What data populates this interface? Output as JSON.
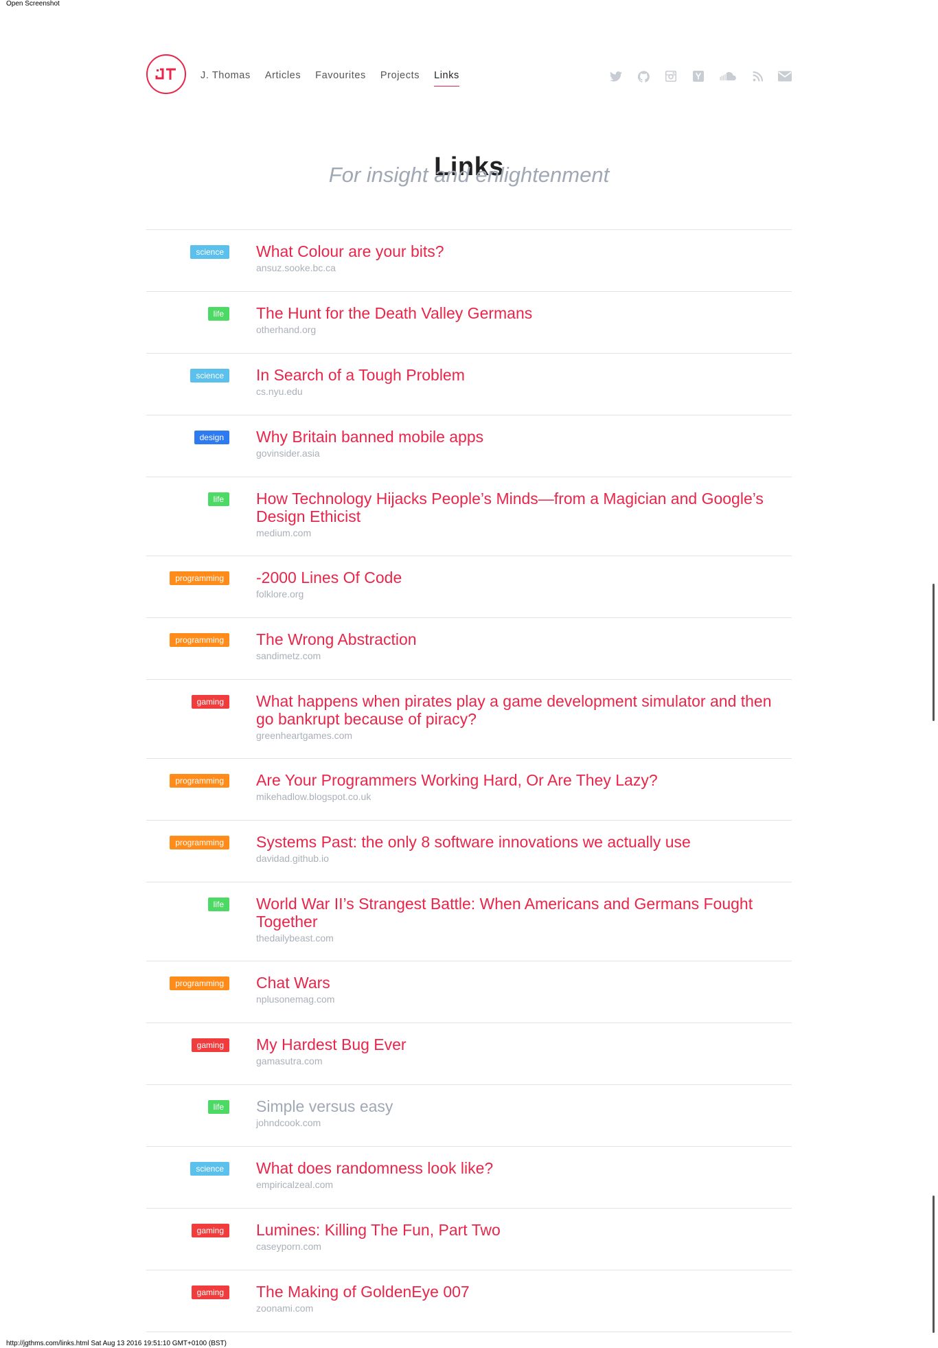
{
  "print": {
    "header": "Open Screenshot",
    "footer": "http://jgthms.com/links.html Sat Aug 13 2016 19:51:10 GMT+0100 (BST)"
  },
  "brand": {
    "logo_text": "JT",
    "accent": "#e8264a"
  },
  "nav": [
    {
      "label": "J. Thomas",
      "active": false
    },
    {
      "label": "Articles",
      "active": false
    },
    {
      "label": "Favourites",
      "active": false
    },
    {
      "label": "Projects",
      "active": false
    },
    {
      "label": "Links",
      "active": true
    }
  ],
  "social": [
    "twitter-icon",
    "github-icon",
    "instagram-icon",
    "hackernews-icon",
    "soundcloud-icon",
    "rss-icon",
    "email-icon"
  ],
  "page": {
    "title": "Links",
    "subtitle": "For insight and enlightenment"
  },
  "tag_colors": {
    "science": "#5bc0eb",
    "life": "#4cd964",
    "design": "#2e7af0",
    "programming": "#ff8c1a",
    "gaming": "#f03c3c"
  },
  "links": [
    {
      "tag": "science",
      "title": "What Colour are your bits?",
      "domain": "ansuz.sooke.bc.ca",
      "visited": false
    },
    {
      "tag": "life",
      "title": "The Hunt for the Death Valley Germans",
      "domain": "otherhand.org",
      "visited": false
    },
    {
      "tag": "science",
      "title": "In Search of a Tough Problem",
      "domain": "cs.nyu.edu",
      "visited": false
    },
    {
      "tag": "design",
      "title": "Why Britain banned mobile apps",
      "domain": "govinsider.asia",
      "visited": false
    },
    {
      "tag": "life",
      "title": "How Technology Hijacks People’s Minds—from a Magician and Google’s Design Ethicist",
      "domain": "medium.com",
      "visited": false
    },
    {
      "tag": "programming",
      "title": "-2000 Lines Of Code",
      "domain": "folklore.org",
      "visited": false
    },
    {
      "tag": "programming",
      "title": "The Wrong Abstraction",
      "domain": "sandimetz.com",
      "visited": false
    },
    {
      "tag": "gaming",
      "title": "What happens when pirates play a game development simulator and then go bankrupt because of piracy?",
      "domain": "greenheartgames.com",
      "visited": false
    },
    {
      "tag": "programming",
      "title": "Are Your Programmers Working Hard, Or Are They Lazy?",
      "domain": "mikehadlow.blogspot.co.uk",
      "visited": false
    },
    {
      "tag": "programming",
      "title": "Systems Past: the only 8 software innovations we actually use",
      "domain": "davidad.github.io",
      "visited": false
    },
    {
      "tag": "life",
      "title": "World War II’s Strangest Battle: When Americans and Germans Fought Together",
      "domain": "thedailybeast.com",
      "visited": false
    },
    {
      "tag": "programming",
      "title": "Chat Wars",
      "domain": "nplusonemag.com",
      "visited": false
    },
    {
      "tag": "gaming",
      "title": "My Hardest Bug Ever",
      "domain": "gamasutra.com",
      "visited": false
    },
    {
      "tag": "life",
      "title": "Simple versus easy",
      "domain": "johndcook.com",
      "visited": true
    },
    {
      "tag": "science",
      "title": "What does randomness look like?",
      "domain": "empiricalzeal.com",
      "visited": false
    },
    {
      "tag": "gaming",
      "title": "Lumines: Killing The Fun, Part Two",
      "domain": "caseyporn.com",
      "visited": false
    },
    {
      "tag": "gaming",
      "title": "The Making of GoldenEye 007",
      "domain": "zoonami.com",
      "visited": false
    }
  ]
}
